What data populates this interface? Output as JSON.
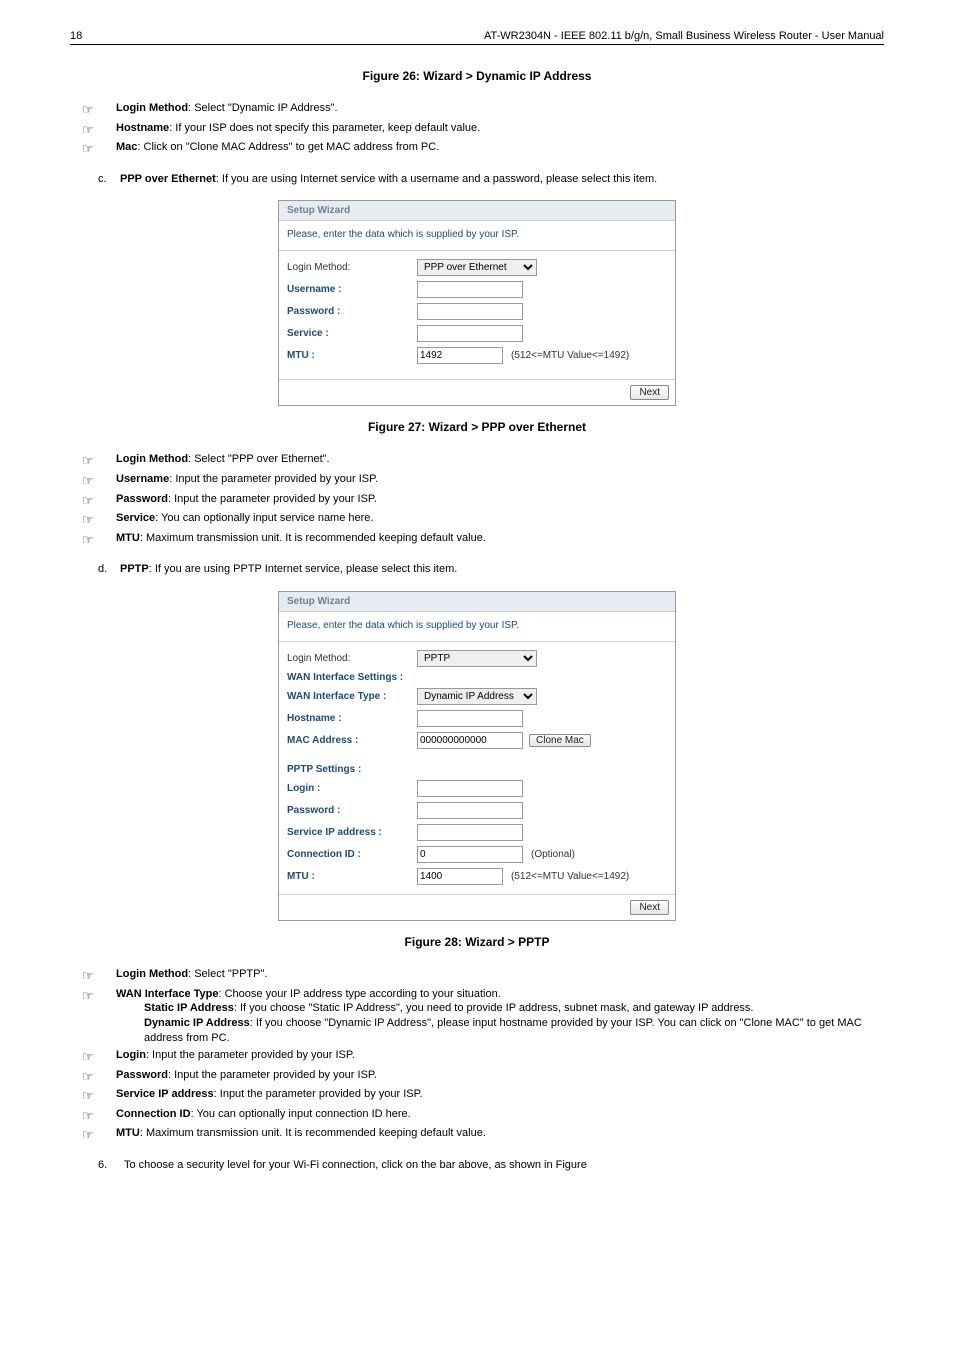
{
  "header": {
    "page_number": "18",
    "title": "AT-WR2304N - IEEE 802.11 b/g/n, Small Business Wireless Router - User Manual"
  },
  "captions": {
    "fig26": "Figure 26: Wizard > Dynamic IP Address",
    "fig27": "Figure 27: Wizard > PPP over Ethernet",
    "fig28": "Figure 28: Wizard > PPTP"
  },
  "sec26_bullets": [
    {
      "label": "Login Method",
      "rest": ": Select \"Dynamic IP Address\"."
    },
    {
      "label": "Hostname",
      "rest": ": If your ISP does not specify this parameter, keep default value."
    },
    {
      "label": "Mac",
      "rest": ": Click on \"Clone MAC Address\" to get MAC address from PC."
    }
  ],
  "step_c": {
    "letter": "c.",
    "label": "PPP over Ethernet",
    "rest": ": If you are using Internet service with a username and a password, please select this item."
  },
  "dialog27": {
    "title": "Setup Wizard",
    "subtitle": "Please, enter the data which is supplied by your ISP.",
    "rows": {
      "login_method_label": "Login Method:",
      "login_method_value": "PPP over Ethernet",
      "username_label": "Username :",
      "password_label": "Password :",
      "service_label": "Service :",
      "mtu_label": "MTU :",
      "mtu_value": "1492",
      "mtu_hint": "(512<=MTU Value<=1492)"
    },
    "next": "Next"
  },
  "sec27_bullets": [
    {
      "label": "Login Method",
      "rest": ": Select \"PPP over Ethernet\"."
    },
    {
      "label": "Username",
      "rest": ": Input the parameter provided by your ISP."
    },
    {
      "label": "Password",
      "rest": ": Input the parameter provided by your ISP."
    },
    {
      "label": "Service",
      "rest": ": You can optionally input service name here."
    },
    {
      "label": "MTU",
      "rest": ": Maximum transmission unit. It is recommended keeping default value."
    }
  ],
  "step_d": {
    "letter": "d.",
    "label": "PPTP",
    "rest": ": If you are using PPTP Internet service, please select this item."
  },
  "dialog28": {
    "title": "Setup Wizard",
    "subtitle": "Please, enter the data which is supplied by your ISP.",
    "rows": {
      "login_method_label": "Login Method:",
      "login_method_value": "PPTP",
      "wan_settings_label": "WAN Interface Settings :",
      "wan_type_label": "WAN Interface Type :",
      "wan_type_value": "Dynamic IP Address",
      "hostname_label": "Hostname :",
      "mac_label": "MAC Address :",
      "mac_value": "000000000000",
      "clone_btn": "Clone Mac",
      "pptp_settings_label": "PPTP Settings :",
      "login_label": "Login :",
      "password_label": "Password :",
      "service_ip_label": "Service IP address :",
      "conn_id_label": "Connection ID :",
      "conn_id_value": "0",
      "conn_id_hint": "(Optional)",
      "mtu_label": "MTU :",
      "mtu_value": "1400",
      "mtu_hint": "(512<=MTU Value<=1492)"
    },
    "next": "Next"
  },
  "sec28_bullets_a": [
    {
      "label": "Login Method",
      "rest": ": Select \"PPTP\"."
    }
  ],
  "wan_block": {
    "label": "WAN Interface Type",
    "rest": ": Choose your IP address type according to your situation.",
    "static_label": "Static IP Address",
    "static_rest": ": If you choose \"Static IP Address\", you need to provide IP address, subnet mask, and gateway IP address.",
    "dynamic_label": "Dynamic IP Address",
    "dynamic_rest": ": If you choose \"Dynamic IP Address\", please input hostname provided by your ISP. You can click on \"Clone MAC\" to get MAC address from PC."
  },
  "sec28_bullets_b": [
    {
      "label": "Login",
      "rest": ": Input the parameter provided by your ISP."
    },
    {
      "label": "Password",
      "rest": ": Input the parameter provided by your ISP."
    },
    {
      "label": "Service IP address",
      "rest": ": Input the parameter provided by your ISP."
    },
    {
      "label": "Connection ID",
      "rest": ": You can optionally input connection ID here."
    },
    {
      "label": "MTU",
      "rest": ": Maximum transmission unit. It is recommended keeping default value."
    }
  ],
  "step6": {
    "num": "6.",
    "text": "To choose a security level for your Wi-Fi connection, click on the bar above, as shown in Figure"
  }
}
